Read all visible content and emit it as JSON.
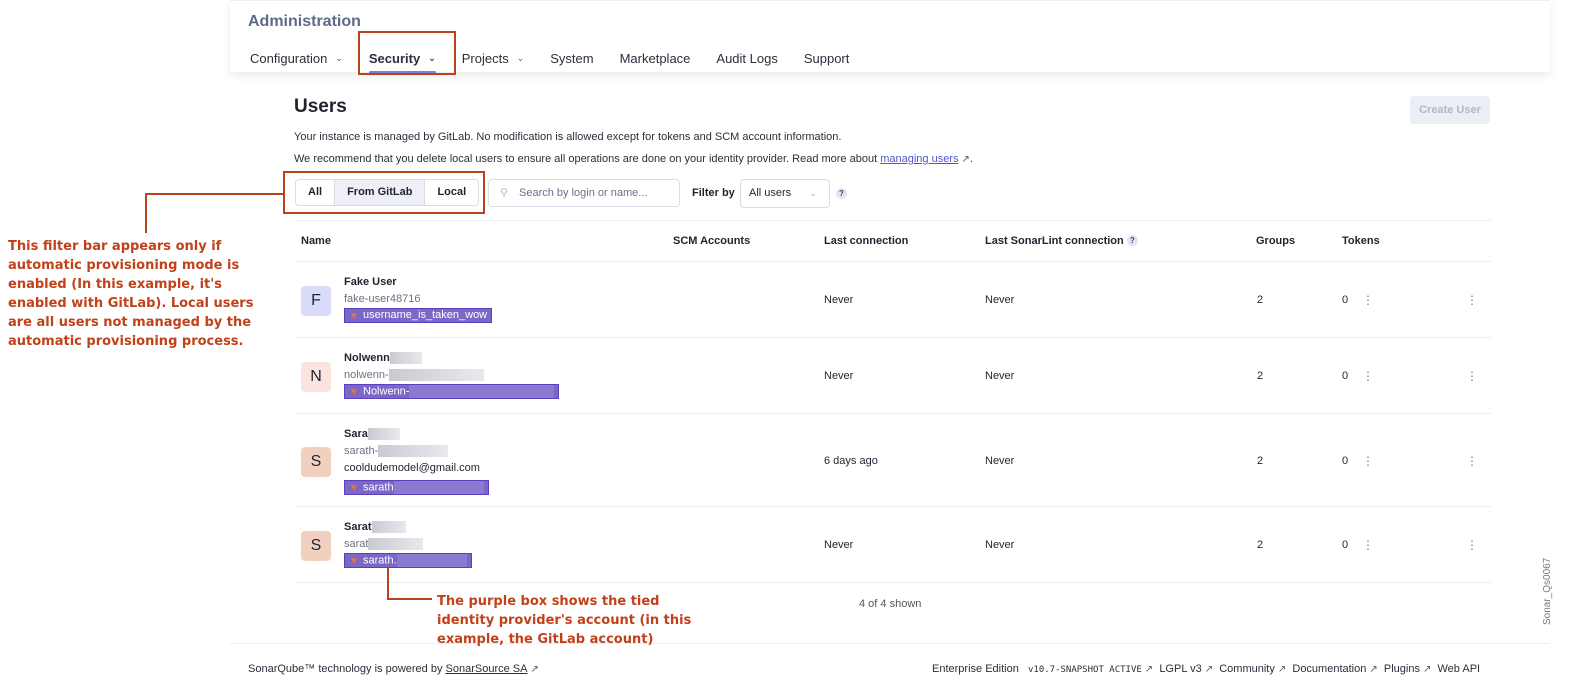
{
  "header": {
    "title": "Administration",
    "nav": [
      {
        "label": "Configuration",
        "dropdown": true
      },
      {
        "label": "Security",
        "dropdown": true,
        "active": true
      },
      {
        "label": "Projects",
        "dropdown": true
      },
      {
        "label": "System"
      },
      {
        "label": "Marketplace"
      },
      {
        "label": "Audit Logs"
      },
      {
        "label": "Support"
      }
    ]
  },
  "users": {
    "title": "Users",
    "create_label": "Create User",
    "info1": "Your instance is managed by GitLab. No modification is allowed except for tokens and SCM account information.",
    "info2": "We recommend that you delete local users to ensure all operations are done on your identity provider. Read more about ",
    "info2_link": "managing users",
    "segments": [
      "All",
      "From GitLab",
      "Local"
    ],
    "search_placeholder": "Search by login or name...",
    "filter_label": "Filter by",
    "filter_value": "All users",
    "columns": [
      "Name",
      "SCM Accounts",
      "Last connection",
      "Last SonarLint connection",
      "Groups",
      "Tokens"
    ],
    "rows": [
      {
        "initial": "F",
        "name": "Fake User",
        "login": "fake-user48716",
        "email": "",
        "gitlab": "username_is_taken_wow",
        "last": "Never",
        "sonarlint": "Never",
        "groups": "2",
        "tokens": "0",
        "avatar_bg": "#d9dcf8"
      },
      {
        "initial": "N",
        "name": "Nolwenn",
        "login": "nolwenn-",
        "email": "",
        "gitlab": "Nolwenn-",
        "last": "Never",
        "sonarlint": "Never",
        "groups": "2",
        "tokens": "0",
        "avatar_bg": "#fbe3e0"
      },
      {
        "initial": "S",
        "name": "Sara",
        "login": "sarath-",
        "email": "cooldudemodel@gmail.com",
        "gitlab": "sarath",
        "last": "6 days ago",
        "sonarlint": "Never",
        "groups": "2",
        "tokens": "0",
        "avatar_bg": "#f1d0c0"
      },
      {
        "initial": "S",
        "name": "Sarat",
        "login": "sarat",
        "email": "",
        "gitlab": "sarath.",
        "last": "Never",
        "sonarlint": "Never",
        "groups": "2",
        "tokens": "0",
        "avatar_bg": "#f1d0c0"
      }
    ],
    "shown": "4 of 4 shown"
  },
  "footer": {
    "powered": "SonarQube™ technology is powered by ",
    "powered_link": "SonarSource SA",
    "edition": "Enterprise Edition",
    "version": "v10.7-SNAPSHOT ACTIVE",
    "links": [
      "LGPL v3",
      "Community",
      "Documentation",
      "Plugins",
      "Web API"
    ]
  },
  "annotations": {
    "filter": "This filter bar appears only if automatic provisioning mode is enabled (In this example, it's enabled with GitLab). Local users are all users not managed by the automatic provisioning process.",
    "purple": "The purple box shows the tied identity provider's account (in this example, the GitLab account)",
    "image_id": "Sonar_Qs0067"
  },
  "colors": {
    "annotation": "#b8431d",
    "gitlab_box": "#7b68c6",
    "accent": "#7b7fdb"
  }
}
